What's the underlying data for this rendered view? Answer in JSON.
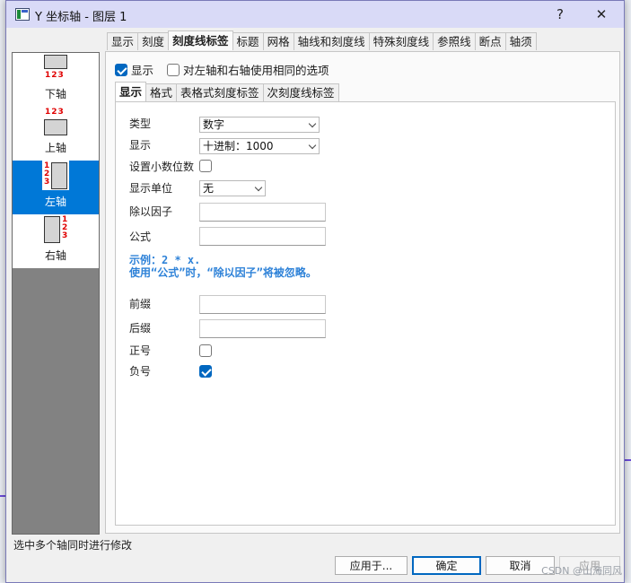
{
  "window": {
    "title": "Y 坐标轴 - 图层 1",
    "help_label": "?",
    "close_label": "✕"
  },
  "main_tabs": [
    {
      "label": "显示"
    },
    {
      "label": "刻度"
    },
    {
      "label": "刻度线标签"
    },
    {
      "label": "标题"
    },
    {
      "label": "网格"
    },
    {
      "label": "轴线和刻度线"
    },
    {
      "label": "特殊刻度线"
    },
    {
      "label": "参照线"
    },
    {
      "label": "断点"
    },
    {
      "label": "轴须"
    }
  ],
  "axis_list": [
    {
      "label": "下轴",
      "icon_digits": "123",
      "icon": "bottom-axis-icon"
    },
    {
      "label": "上轴",
      "icon_digits": "123",
      "icon": "top-axis-icon"
    },
    {
      "label": "左轴",
      "icon_digits": [
        "1",
        "2",
        "3"
      ],
      "icon": "left-axis-icon",
      "selected": true
    },
    {
      "label": "右轴",
      "icon_digits": [
        "1",
        "2",
        "3"
      ],
      "icon": "right-axis-icon"
    }
  ],
  "panel": {
    "show_label": "显示",
    "show_checked": true,
    "same_options_label": "对左轴和右轴使用相同的选项",
    "same_options_checked": false
  },
  "sub_tabs": [
    {
      "label": "显示"
    },
    {
      "label": "格式"
    },
    {
      "label": "表格式刻度标签"
    },
    {
      "label": "次刻度线标签"
    }
  ],
  "form": {
    "type_label": "类型",
    "type_value": "数字",
    "display_label": "显示",
    "display_value": "十进制：1000",
    "decimals_label": "设置小数位数",
    "decimals_checked": false,
    "unit_label": "显示单位",
    "unit_value": "无",
    "divide_label": "除以因子",
    "divide_value": "",
    "formula_label": "公式",
    "formula_value": "",
    "hint_line1": "示例：2 * x.",
    "hint_line2": "使用“公式”时，“除以因子”将被忽略。",
    "prefix_label": "前缀",
    "prefix_value": "",
    "suffix_label": "后缀",
    "suffix_value": "",
    "plus_label": "正号",
    "plus_checked": false,
    "minus_label": "负号",
    "minus_checked": true
  },
  "status_text": "选中多个轴同时进行修改",
  "buttons": {
    "apply_to": "应用于...",
    "ok": "确定",
    "cancel": "取消",
    "apply": "应用"
  },
  "watermark": "CSDN @山海同风",
  "colors": {
    "selection": "#0078d7",
    "checkbox_checked": "#0067c0",
    "hint": "#2e82d8",
    "axis_digits": "#e00000"
  }
}
